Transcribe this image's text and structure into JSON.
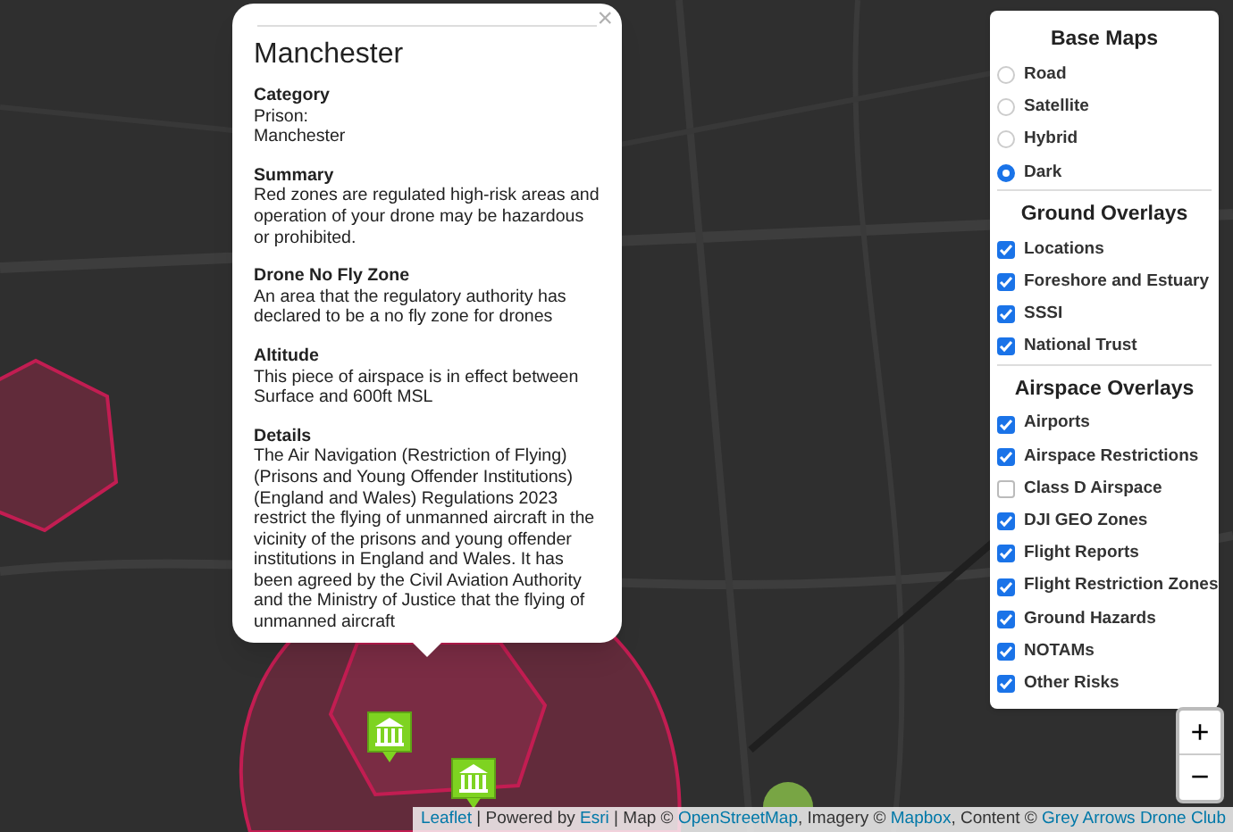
{
  "popup": {
    "close": "×",
    "title": "Manchester",
    "sections": [
      {
        "heading": "Category",
        "lines": [
          "Prison:",
          "Manchester"
        ]
      },
      {
        "heading": "Summary",
        "lines": [
          "Red zones are regulated high-risk areas and operation of your drone may be hazardous or prohibited."
        ]
      },
      {
        "heading": "Drone No Fly Zone",
        "lines": [
          "An area that the regulatory authority has declared to be a no fly zone for drones"
        ]
      },
      {
        "heading": "Altitude",
        "lines": [
          "This piece of airspace is in effect between Surface and 600ft MSL"
        ]
      },
      {
        "heading": "Details",
        "lines": [
          "The Air Navigation (Restriction of Flying) (Prisons and Young Offender Institutions) (England and Wales) Regulations 2023 restrict the flying of unmanned aircraft in the vicinity of the prisons and young offender institutions in England and Wales. It has been agreed by the Civil Aviation Authority and the Ministry of Justice that the flying of unmanned aircraft"
        ]
      }
    ]
  },
  "layers": {
    "sections": [
      {
        "title": "Base Maps",
        "items": [
          {
            "label": "Road",
            "kind": "radio",
            "selected": false
          },
          {
            "label": "Satellite",
            "kind": "radio",
            "selected": false
          },
          {
            "label": "Hybrid",
            "kind": "radio",
            "selected": false
          },
          {
            "label": "Dark",
            "kind": "radio",
            "selected": true
          }
        ]
      },
      {
        "title": "Ground Overlays",
        "items": [
          {
            "label": "Locations",
            "kind": "checkbox",
            "checked": true
          },
          {
            "label": "Foreshore and Estuary",
            "kind": "checkbox",
            "checked": true
          },
          {
            "label": "SSSI",
            "kind": "checkbox",
            "checked": true
          },
          {
            "label": "National Trust",
            "kind": "checkbox",
            "checked": true
          }
        ]
      },
      {
        "title": "Airspace Overlays",
        "items": [
          {
            "label": "Airports",
            "kind": "checkbox",
            "checked": true
          },
          {
            "label": "Airspace Restrictions",
            "kind": "checkbox",
            "checked": true
          },
          {
            "label": "Class D Airspace",
            "kind": "checkbox",
            "checked": false
          },
          {
            "label": "DJI GEO Zones",
            "kind": "checkbox",
            "checked": true
          },
          {
            "label": "Flight Reports",
            "kind": "checkbox",
            "checked": true
          },
          {
            "label": "Flight Restriction Zones",
            "kind": "checkbox",
            "checked": true
          },
          {
            "label": "Ground Hazards",
            "kind": "checkbox",
            "checked": true
          },
          {
            "label": "NOTAMs",
            "kind": "checkbox",
            "checked": true
          },
          {
            "label": "Other Risks",
            "kind": "checkbox",
            "checked": true
          }
        ]
      }
    ]
  },
  "zoom": {
    "in": "+",
    "out": "−"
  },
  "attribution": [
    {
      "text": "Leaflet",
      "kind": "link"
    },
    {
      "text": " | Powered by ",
      "kind": "text"
    },
    {
      "text": "Esri",
      "kind": "link"
    },
    {
      "text": " | Map © ",
      "kind": "text"
    },
    {
      "text": "OpenStreetMap",
      "kind": "link"
    },
    {
      "text": ", Imagery © ",
      "kind": "text"
    },
    {
      "text": "Mapbox",
      "kind": "link"
    },
    {
      "text": ", Content © ",
      "kind": "text"
    },
    {
      "text": "Grey Arrows Drone Club",
      "kind": "link"
    }
  ]
}
